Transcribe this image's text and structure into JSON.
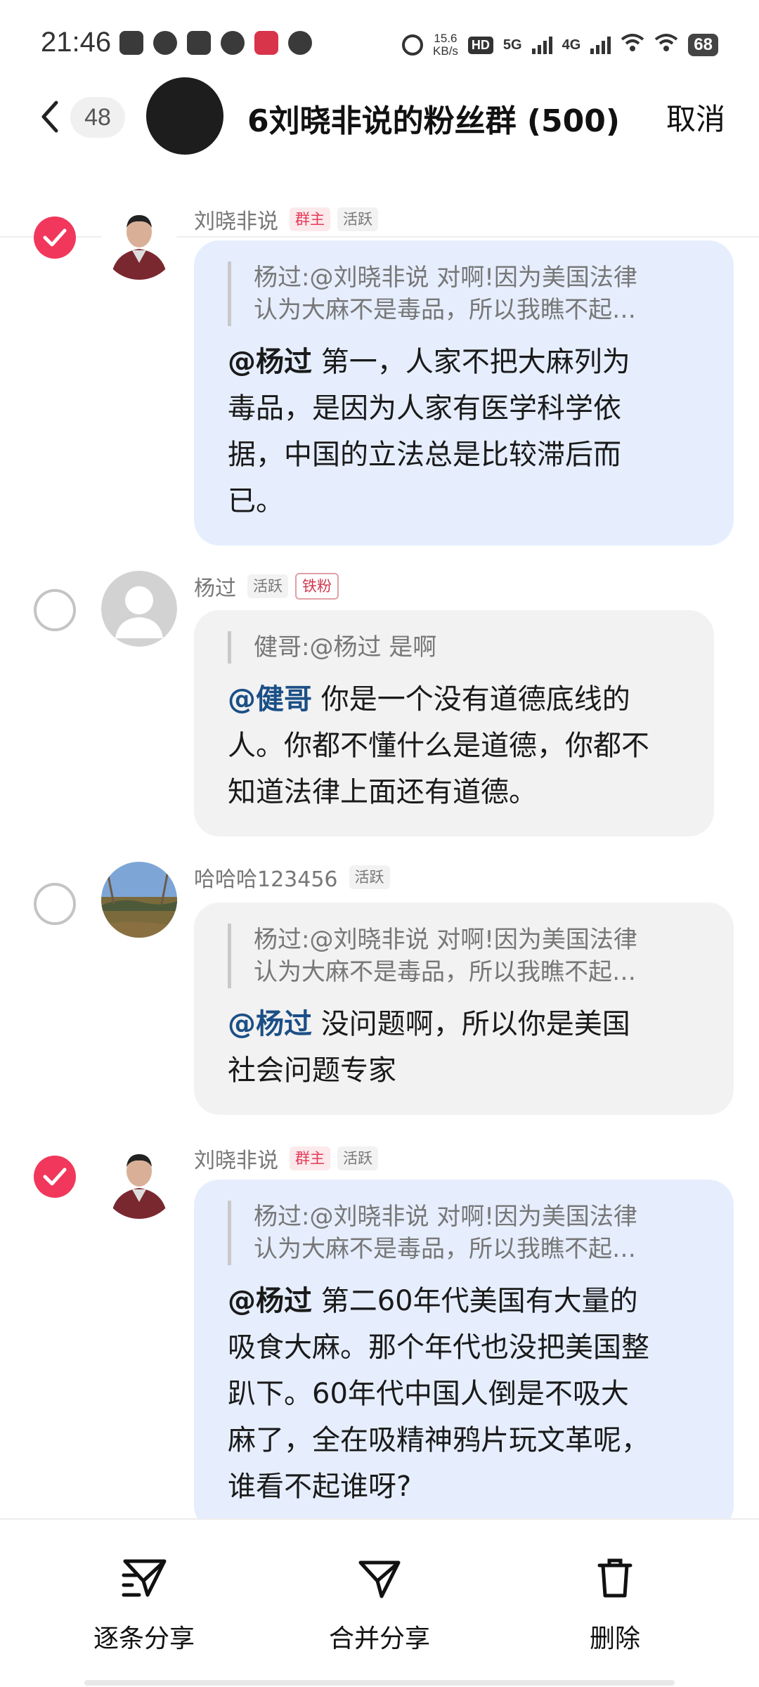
{
  "status_bar": {
    "time": "21:46",
    "net_speed_value": "15.6",
    "net_speed_unit": "KB/s",
    "hd_label": "HD",
    "network_1": "5G",
    "network_2": "4G",
    "battery": "68"
  },
  "header": {
    "unread_count": "48",
    "group_title": "6刘晓非说的粉丝群 (500)",
    "cancel_label": "取消"
  },
  "messages": [
    {
      "sender": "刘晓非说",
      "tags": [
        "群主",
        "活跃"
      ],
      "selected": true,
      "quote_lines": [
        "杨过:@刘晓非说 对啊!因为美国法律",
        "认为大麻不是毒品，所以我瞧不起…"
      ],
      "mention": "@杨过",
      "body_lines": [
        " 第一，人家不把大麻列为",
        "毒品，是因为人家有医学科学依",
        "据，中国的立法总是比较滞后而",
        "已。"
      ]
    },
    {
      "sender": "杨过",
      "tags": [
        "活跃",
        "铁粉"
      ],
      "selected": false,
      "quote_lines": [
        "健哥:@杨过 是啊"
      ],
      "mention": "@健哥",
      "body_lines": [
        " 你是一个没有道德底线的",
        "人。你都不懂什么是道德，你都不",
        "知道法律上面还有道德。"
      ]
    },
    {
      "sender": "哈哈哈123456",
      "tags": [
        "活跃"
      ],
      "selected": false,
      "quote_lines": [
        "杨过:@刘晓非说 对啊!因为美国法律",
        "认为大麻不是毒品，所以我瞧不起…"
      ],
      "mention": "@杨过",
      "body_lines": [
        " 没问题啊，所以你是美国",
        "社会问题专家"
      ]
    },
    {
      "sender": "刘晓非说",
      "tags": [
        "群主",
        "活跃"
      ],
      "selected": true,
      "quote_lines": [
        "杨过:@刘晓非说 对啊!因为美国法律",
        "认为大麻不是毒品，所以我瞧不起…"
      ],
      "mention": "@杨过",
      "body_lines": [
        " 第二60年代美国有大量的",
        "吸食大麻。那个年代也没把美国整",
        "趴下。60年代中国人倒是不吸大",
        "麻了，全在吸精神鸦片玩文革呢，",
        "谁看不起谁呀?"
      ]
    }
  ],
  "bottom_bar": {
    "share_each_label": "逐条分享",
    "share_merged_label": "合并分享",
    "delete_label": "删除"
  },
  "colors": {
    "accent": "#f1375b",
    "bubble_owner": "#e6eefe",
    "bubble_other": "#f2f2f2",
    "mention_blue": "#1b4f86"
  },
  "icons": [
    "back-icon",
    "check-icon",
    "share-each-icon",
    "share-merged-icon",
    "trash-icon"
  ]
}
